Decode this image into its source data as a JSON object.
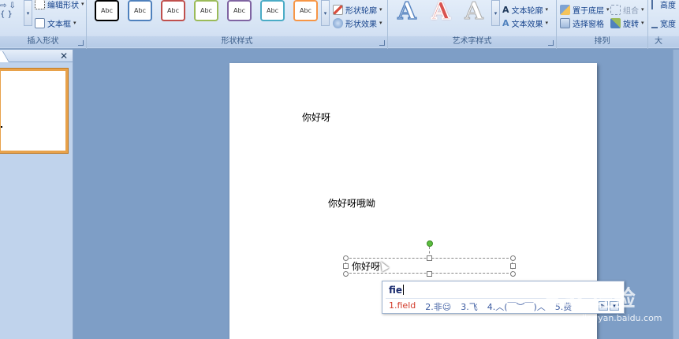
{
  "ribbon": {
    "insert_shapes": {
      "label": "插入形状",
      "edit_shape": "编辑形状",
      "text_box": "文本框"
    },
    "shape_styles": {
      "label": "形状样式",
      "swatch_text": "Abc",
      "swatch_colors": [
        "#000000",
        "#4f81bd",
        "#c0504d",
        "#9bbb59",
        "#8064a2",
        "#4bacc6",
        "#f79646"
      ],
      "shape_outline": "形状轮廓",
      "shape_effects": "形状效果"
    },
    "wordart_styles": {
      "label": "艺术字样式",
      "letter": "A",
      "text_outline": "文本轮廓",
      "text_effects": "文本效果"
    },
    "arrange": {
      "label": "排列",
      "send_to_back": "置于底层",
      "group": "组合",
      "selection_pane": "选择窗格",
      "rotate": "旋转"
    },
    "size": {
      "label": "大",
      "height": "高度",
      "width": "宽度"
    }
  },
  "slide": {
    "text1": "你好呀",
    "text2": "你好呀哦呦",
    "text3": "你好呀"
  },
  "ime": {
    "input": "fie",
    "candidates": [
      "1.field",
      "2.非☺",
      "3.飞",
      "4.︿(￣︶￣)︿",
      "5.费"
    ]
  },
  "watermark": {
    "brand": "Bai 经验",
    "url": "jingyan.baidu.com"
  }
}
